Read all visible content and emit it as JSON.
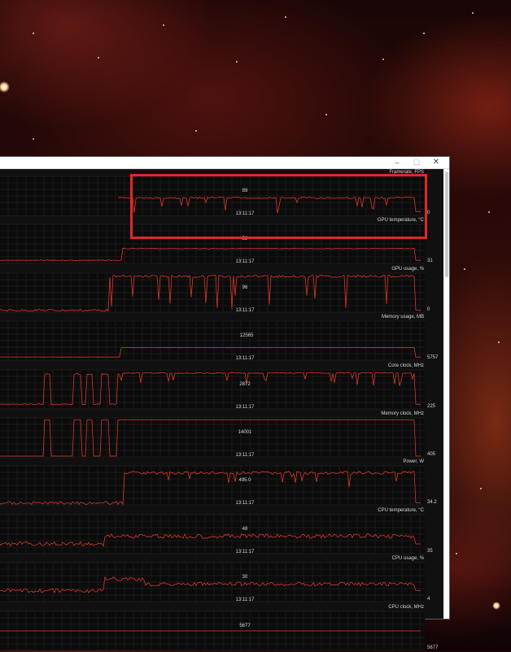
{
  "window": {
    "controls": {
      "minimize": "–",
      "maximize": "☐",
      "close": "✕"
    }
  },
  "panels": [
    {
      "title": "Framerate, FPS",
      "value": "89",
      "time": "13:11:17",
      "min_label": "0"
    },
    {
      "title": "GPU temperature, °C",
      "value": "52",
      "time": "13:11:17",
      "min_label": "31"
    },
    {
      "title": "GPU usage, %",
      "value": "96",
      "time": "13:11:17",
      "min_label": "0"
    },
    {
      "title": "Memory usage, MB",
      "value": "12565",
      "time": "13:11:17",
      "min_label": "5757"
    },
    {
      "title": "Core clock, MHz",
      "value": "2872",
      "time": "13:11:17",
      "min_label": "225"
    },
    {
      "title": "Memory clock, MHz",
      "value": "14001",
      "time": "13:11:17",
      "min_label": "405"
    },
    {
      "title": "Power, W",
      "value": "495.0",
      "time": "13:11:17",
      "min_label": "34.2"
    },
    {
      "title": "CPU temperature, °C",
      "value": "48",
      "time": "13:11:17",
      "min_label": "35"
    },
    {
      "title": "CPU usage, %",
      "value": "30",
      "time": "13:11:17",
      "min_label": "4"
    },
    {
      "title": "CPU clock, MHz",
      "value": "5677",
      "time": "",
      "min_label": "5677"
    }
  ],
  "colors": {
    "trace": "#d9382b",
    "grid": "#262626",
    "panel_bg": "#0b0b0b",
    "highlight": "#e3262b"
  }
}
